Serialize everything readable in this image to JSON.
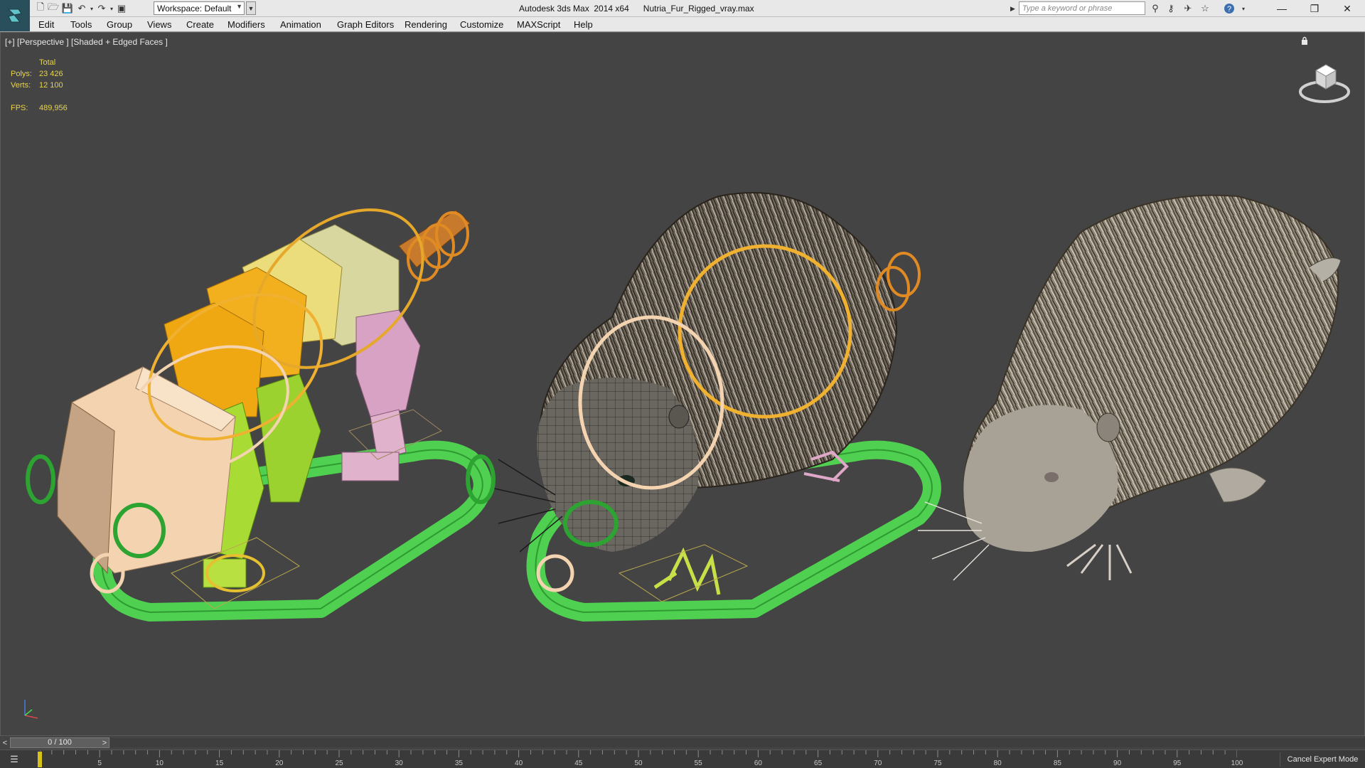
{
  "titlebar": {
    "app_title": "Autodesk 3ds Max  2014 x64",
    "file_name": "Nutria_Fur_Rigged_vray.max",
    "workspace_label": "Workspace: Default",
    "search_placeholder": "Type a keyword or phrase",
    "quick_access_icons": [
      "new-file-icon",
      "open-folder-icon",
      "save-icon",
      "undo-icon",
      "redo-icon",
      "project-folder-icon"
    ],
    "help_icons": [
      "binoculars-icon",
      "key-icon",
      "satellite-icon",
      "star-icon",
      "help-icon"
    ],
    "window_controls": [
      "minimize-icon",
      "restore-icon",
      "close-icon"
    ]
  },
  "menu": {
    "items": [
      "Edit",
      "Tools",
      "Group",
      "Views",
      "Create",
      "Modifiers",
      "Animation",
      "Graph Editors",
      "Rendering",
      "Customize",
      "MAXScript",
      "Help"
    ]
  },
  "viewport": {
    "label": "[+] [Perspective ] [Shaded + Edged Faces ]",
    "stats": {
      "header": "Total",
      "polys_label": "Polys:",
      "polys_value": "23 426",
      "verts_label": "Verts:",
      "verts_value": "12 100",
      "fps_label": "FPS:",
      "fps_value": "489,956"
    }
  },
  "timeline": {
    "frame_display": "0 / 100",
    "current_frame": 0,
    "range": [
      0,
      100
    ],
    "tick_labels": [
      "0",
      "5",
      "10",
      "15",
      "20",
      "25",
      "30",
      "35",
      "40",
      "45",
      "50",
      "55",
      "60",
      "65",
      "70",
      "75",
      "80",
      "85",
      "90",
      "95",
      "100"
    ],
    "cancel_expert_mode": "Cancel Expert Mode"
  },
  "colors": {
    "viewport_bg": "#444444",
    "stats_text": "#e8d44a",
    "rig_green": "#4fd050",
    "bone_yellow": "#f2b01e",
    "bone_green": "#9cd230",
    "bone_pink": "#d8a2c4",
    "bone_peach": "#f3d3b0",
    "ring_orange": "#e08a24"
  }
}
